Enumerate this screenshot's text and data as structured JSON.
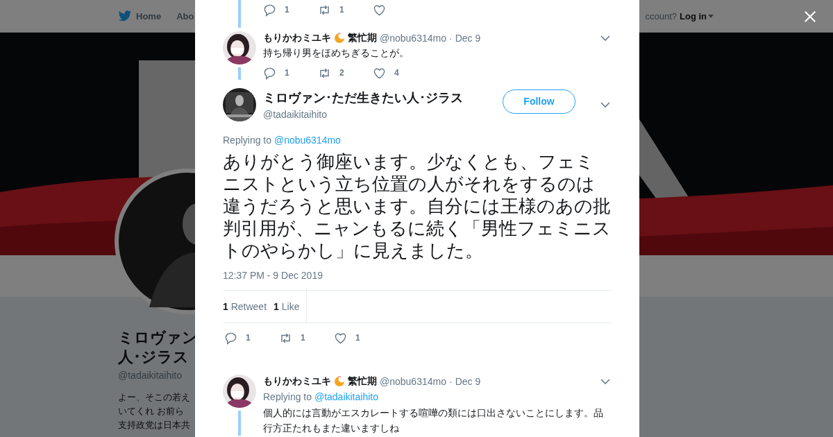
{
  "header": {
    "nav": [
      {
        "label": "Home",
        "kind": "home"
      },
      {
        "label": "Abo",
        "kind": "plain"
      }
    ],
    "login_prompt": "ccount?",
    "login": "Log in"
  },
  "profile": {
    "name_lines": [
      "ミロヴァン",
      "人･ジラス"
    ],
    "handle": "@tadaikitaihito",
    "bio_lines": [
      "よー、そこの若え",
      "いてくれ お前ら",
      "支持政党は日本共"
    ]
  },
  "modal": {
    "top_actions": {
      "reply": "1",
      "retweet": "1"
    },
    "thread": [
      {
        "name": "もりかわミユキ",
        "name_suffix": "繁忙期",
        "handle": "@nobu6314mo",
        "separator": "·",
        "date": "Dec 9",
        "text": "持ち帰り男をほめちぎることが。",
        "replies": "1",
        "retweets": "2",
        "likes": "4"
      }
    ],
    "main": {
      "name": "ミロヴァン･ただ生きたい人･ジラス",
      "handle": "@tadaikitaihito",
      "follow": "Follow",
      "replying_label": "Replying to",
      "replying_to": "@nobu6314mo",
      "text": "ありがとう御座います。少なくとも、フェミニストという立ち位置の人がそれをするのは違うだろうと思います。自分には王様のあの批判引用が、ニャンもるに続く「男性フェミニストのやらかし」に見えました。",
      "timestamp": "12:37 PM - 9 Dec 2019",
      "retweet_count": "1",
      "retweet_label": "Retweet",
      "like_count": "1",
      "like_label": "Like",
      "replies": "1",
      "retweets": "1",
      "likes": "1"
    },
    "replies": [
      {
        "name": "もりかわミユキ",
        "name_suffix": "繁忙期",
        "handle": "@nobu6314mo",
        "separator": "·",
        "date": "Dec 9",
        "replying_label": "Replying to",
        "replying_to": "@tadaikitaihito",
        "text": "個人的には言動がエスカレートする喧嘩の類には口出さないことにします。品行方正たれもまた違いますしね"
      }
    ]
  }
}
